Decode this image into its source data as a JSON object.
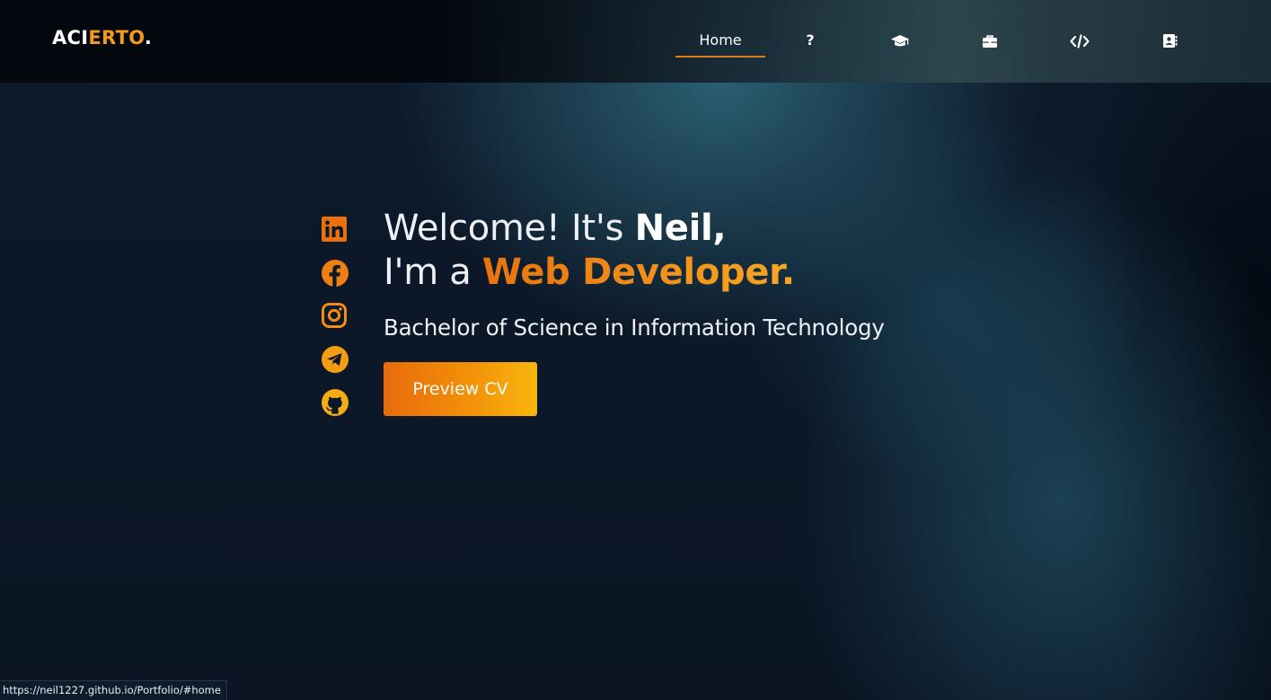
{
  "logo": {
    "part1": "ACI",
    "part2": "ERTO",
    "dot": "."
  },
  "nav": {
    "home_label": "Home",
    "about_label": "?",
    "items_icons": [
      "graduation-cap-icon",
      "briefcase-icon",
      "code-icon",
      "contact-book-icon"
    ]
  },
  "hero": {
    "line1_prefix": "Welcome! It's ",
    "name": "Neil,",
    "line2_prefix": "I'm a ",
    "role": "Web Developer.",
    "subtitle": "Bachelor of Science in Information Technology",
    "cta_label": "Preview CV"
  },
  "socials": [
    "linkedin-icon",
    "facebook-icon",
    "instagram-icon",
    "telegram-icon",
    "github-icon"
  ],
  "status_bar": {
    "url": "https://neil1227.github.io/Portfolio/#home"
  },
  "colors": {
    "accent": "#f39a1b",
    "accent_dark": "#e07a1d",
    "background": "#0b1626"
  }
}
